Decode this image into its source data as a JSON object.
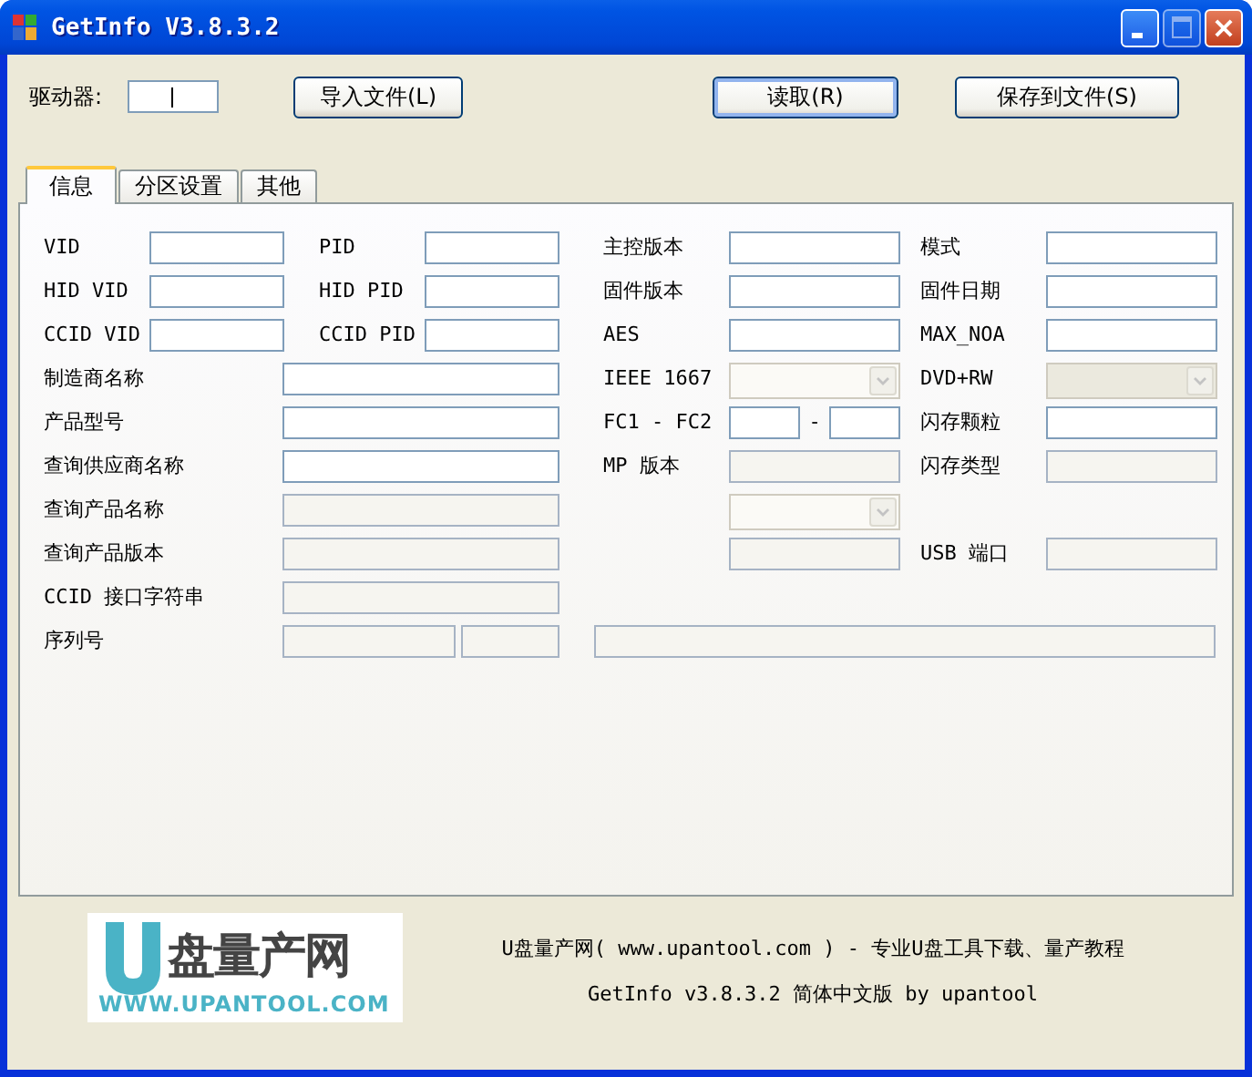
{
  "window": {
    "title": "GetInfo V3.8.3.2",
    "maximize_enabled": false
  },
  "toolbar": {
    "drive_label": "驱动器:",
    "drive_field": {
      "focused": true
    },
    "buttons": [
      {
        "label": "导入文件(L)",
        "kind": "import"
      },
      {
        "label": "读取(R)",
        "kind": "read",
        "default": true
      },
      {
        "label": "保存到文件(S)",
        "kind": "save"
      }
    ]
  },
  "tabs": [
    {
      "label": "信息",
      "selected": true
    },
    {
      "label": "分区设置",
      "selected": false
    },
    {
      "label": "其他",
      "selected": false
    }
  ],
  "rows": [
    {
      "left": [
        {
          "kind": "label",
          "text": "VID"
        },
        {
          "kind": "field",
          "disabled": false
        },
        {
          "kind": "label",
          "text": "PID"
        },
        {
          "kind": "field",
          "disabled": false
        }
      ],
      "right": [
        {
          "kind": "label",
          "text": "主控版本"
        },
        {
          "kind": "field",
          "disabled": false
        },
        {
          "kind": "label",
          "text": "模式"
        },
        {
          "kind": "field",
          "disabled": false
        }
      ]
    },
    {
      "left": [
        {
          "kind": "label",
          "text": "HID VID"
        },
        {
          "kind": "field",
          "disabled": false
        },
        {
          "kind": "label",
          "text": "HID PID"
        },
        {
          "kind": "field",
          "disabled": false
        }
      ],
      "right": [
        {
          "kind": "label",
          "text": "固件版本"
        },
        {
          "kind": "field",
          "disabled": false
        },
        {
          "kind": "label",
          "text": "固件日期"
        },
        {
          "kind": "field",
          "disabled": false
        }
      ]
    },
    {
      "left": [
        {
          "kind": "label",
          "text": "CCID VID"
        },
        {
          "kind": "field",
          "disabled": false
        },
        {
          "kind": "label",
          "text": "CCID PID"
        },
        {
          "kind": "field",
          "disabled": false
        }
      ],
      "right": [
        {
          "kind": "label",
          "text": "AES"
        },
        {
          "kind": "field",
          "disabled": false
        },
        {
          "kind": "label",
          "text": "MAX_NOA"
        },
        {
          "kind": "field",
          "disabled": false
        }
      ]
    },
    {
      "left": [
        {
          "kind": "wide_label",
          "text": "制造商名称"
        },
        {
          "kind": "wide_field",
          "disabled": false
        }
      ],
      "right": [
        {
          "kind": "label",
          "text": "IEEE 1667"
        },
        {
          "kind": "combo",
          "disabled": true
        },
        {
          "kind": "label",
          "text": "DVD+RW"
        },
        {
          "kind": "combo",
          "disabled": true
        }
      ]
    },
    {
      "left": [
        {
          "kind": "wide_label",
          "text": "产品型号"
        },
        {
          "kind": "wide_field",
          "disabled": false
        }
      ],
      "right": [
        {
          "kind": "label",
          "text": "FC1 - FC2"
        },
        {
          "kind": "small_field",
          "disabled": false
        },
        {
          "kind": "dash",
          "text": "-"
        },
        {
          "kind": "tiny_field",
          "disabled": false
        },
        {
          "kind": "label",
          "text": "闪存颗粒"
        },
        {
          "kind": "field",
          "disabled": false
        }
      ]
    },
    {
      "left": [
        {
          "kind": "wide_label",
          "text": "查询供应商名称"
        },
        {
          "kind": "wide_field",
          "disabled": false
        }
      ],
      "right": [
        {
          "kind": "label",
          "text": "MP 版本"
        },
        {
          "kind": "field",
          "disabled": true
        },
        {
          "kind": "label",
          "text": "闪存类型"
        },
        {
          "kind": "field",
          "disabled": true
        }
      ]
    },
    {
      "left": [
        {
          "kind": "wide_label",
          "text": "查询产品名称"
        },
        {
          "kind": "wide_field",
          "disabled": true
        }
      ],
      "right": [
        {
          "kind": "blank"
        },
        {
          "kind": "combo",
          "disabled": true
        }
      ]
    },
    {
      "left": [
        {
          "kind": "wide_label",
          "text": "查询产品版本"
        },
        {
          "kind": "wide_field",
          "disabled": true
        }
      ],
      "right": [
        {
          "kind": "blank"
        },
        {
          "kind": "field",
          "disabled": true
        },
        {
          "kind": "label",
          "text": "USB 端口"
        },
        {
          "kind": "field",
          "disabled": true
        }
      ]
    },
    {
      "left": [
        {
          "kind": "wide_label",
          "text": "CCID 接口字符串"
        },
        {
          "kind": "wide_field",
          "disabled": true
        }
      ],
      "right": []
    },
    {
      "left": [
        {
          "kind": "wide_label",
          "text": "序列号"
        },
        {
          "kind": "serial_field",
          "disabled": true
        },
        {
          "kind": "serial_small",
          "disabled": true
        }
      ],
      "right": [
        {
          "kind": "full_field",
          "disabled": true
        }
      ]
    }
  ],
  "footer": {
    "logo": {
      "name": "盘量产网",
      "url": "WWW.UPANTOOL.COM"
    },
    "lines": [
      "U盘量产网( www.upantool.com ) - 专业U盘工具下载、量产教程",
      "GetInfo v3.8.3.2 简体中文版 by upantool"
    ]
  }
}
